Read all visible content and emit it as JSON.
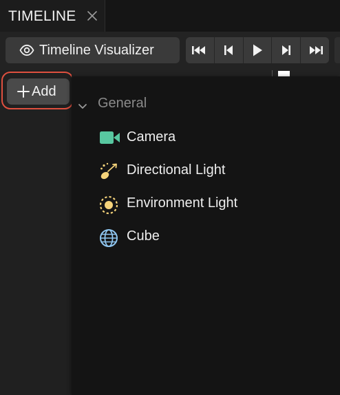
{
  "panel": {
    "title": "TIMELINE"
  },
  "toolbar": {
    "visualizer_label": "Timeline Visualizer",
    "transport": [
      {
        "name": "skip-to-start-icon"
      },
      {
        "name": "step-back-icon"
      },
      {
        "name": "play-icon"
      },
      {
        "name": "step-forward-icon"
      },
      {
        "name": "skip-to-end-icon"
      }
    ]
  },
  "add_button": {
    "label": "Add"
  },
  "menu": {
    "group": "General",
    "items": [
      {
        "label": "Camera",
        "icon": "camera-icon",
        "color": "#58c7a0"
      },
      {
        "label": "Directional Light",
        "icon": "directional-light-icon",
        "color": "#f5d37a"
      },
      {
        "label": "Environment Light",
        "icon": "environment-light-icon",
        "color": "#f5d37a"
      },
      {
        "label": "Cube",
        "icon": "cube-icon",
        "color": "#8fc6f0"
      }
    ]
  },
  "colors": {
    "highlight": "#e0503f",
    "accent_camera": "#58c7a0",
    "accent_light": "#f5d37a",
    "accent_cube": "#8fc6f0"
  }
}
